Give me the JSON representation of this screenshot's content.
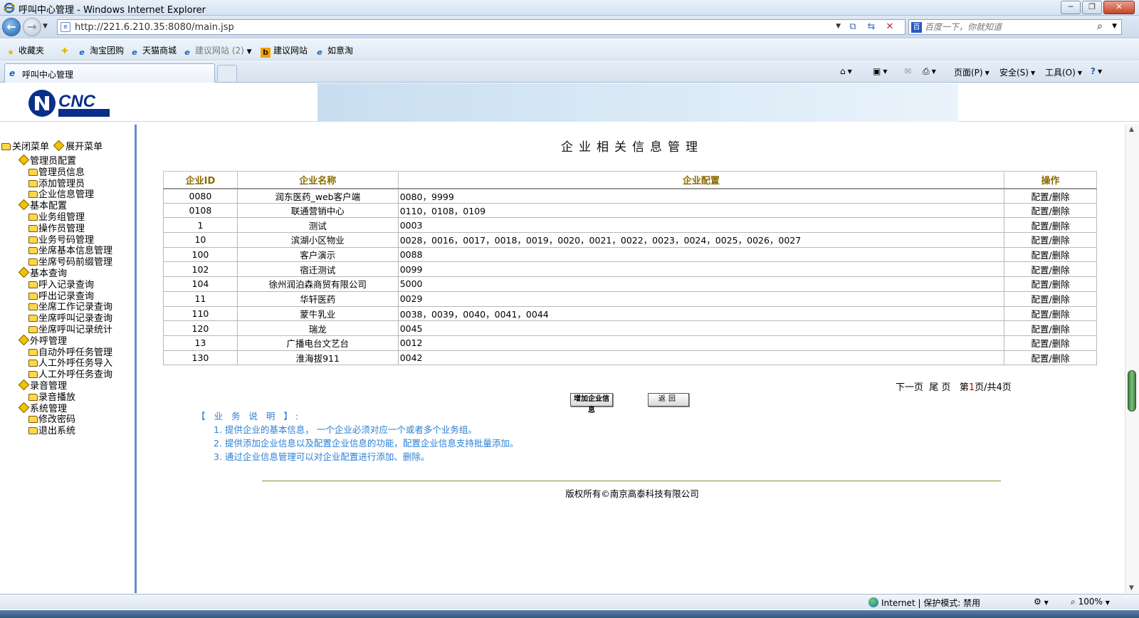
{
  "window": {
    "title": "呼叫中心管理 - Windows Internet Explorer",
    "minimize": "─",
    "restore": "❐",
    "close": "✕"
  },
  "address": {
    "url": "http://221.6.210.35:8080/main.jsp",
    "search_placeholder": "百度一下，你就知道"
  },
  "favorites": {
    "label": "收藏夹",
    "items": [
      "淘宝团购",
      "天猫商城",
      "建议网站 (2)",
      "建议网站",
      "如意淘"
    ]
  },
  "tab": {
    "label": "呼叫中心管理"
  },
  "commands": {
    "page": "页面(P)",
    "safety": "安全(S)",
    "tools": "工具(O)"
  },
  "sidebar": {
    "close_menu": "关闭菜单",
    "expand_menu": "展开菜单",
    "groups": [
      {
        "label": "管理员配置",
        "items": [
          "管理员信息",
          "添加管理员",
          "企业信息管理"
        ]
      },
      {
        "label": "基本配置",
        "items": [
          "业务组管理",
          "操作员管理",
          "业务号码管理",
          "坐席基本信息管理",
          "坐席号码前缀管理"
        ]
      },
      {
        "label": "基本查询",
        "items": [
          "呼入记录查询",
          "呼出记录查询",
          "坐席工作记录查询",
          "坐席呼叫记录查询",
          "坐席呼叫记录统计"
        ]
      },
      {
        "label": "外呼管理",
        "items": [
          "自动外呼任务管理",
          "人工外呼任务导入",
          "人工外呼任务查询"
        ]
      },
      {
        "label": "录音管理",
        "items": [
          "录音播放"
        ]
      },
      {
        "label": "系统管理",
        "items": [
          "修改密码",
          "退出系统"
        ]
      }
    ]
  },
  "main": {
    "title": "企业相关信息管理",
    "table": {
      "headers": [
        "企业ID",
        "企业名称",
        "企业配置",
        "操作"
      ],
      "rows": [
        [
          "0080",
          "润东医药_web客户端",
          "0080，9999",
          "配置/删除"
        ],
        [
          "0108",
          "联通营销中心",
          "0110，0108，0109",
          "配置/删除"
        ],
        [
          "1",
          "测试",
          "0003",
          "配置/删除"
        ],
        [
          "10",
          "滨湖小区物业",
          "0028，0016，0017，0018，0019，0020，0021，0022，0023，0024，0025，0026，0027",
          "配置/删除"
        ],
        [
          "100",
          "客户演示",
          "0088",
          "配置/删除"
        ],
        [
          "102",
          "宿迁测试",
          "0099",
          "配置/删除"
        ],
        [
          "104",
          "徐州润泊森商贸有限公司",
          "5000",
          "配置/删除"
        ],
        [
          "11",
          "华轩医药",
          "0029",
          "配置/删除"
        ],
        [
          "110",
          "蒙牛乳业",
          "0038，0039，0040，0041，0044",
          "配置/删除"
        ],
        [
          "120",
          "瑞龙",
          "0045",
          "配置/删除"
        ],
        [
          "13",
          "广播电台文艺台",
          "0012",
          "配置/删除"
        ],
        [
          "130",
          "淮海拔911",
          "0042",
          "配置/删除"
        ]
      ]
    },
    "pager": {
      "next": "下一页",
      "last": "尾 页",
      "page_prefix": "第",
      "current_page": "1",
      "page_suffix": "页/共4页"
    },
    "buttons": {
      "add": "增加企业信息",
      "back": "返回"
    },
    "notes": {
      "heading": "【 业 务 说 明 】:",
      "items": [
        "1.  提供企业的基本信息， 一个企业必须对应一个或者多个业务组。",
        "2.  提供添加企业信息以及配置企业信息的功能，配置企业信息支持批量添加。",
        "3.  通过企业信息管理可以对企业配置进行添加、删除。"
      ]
    },
    "copyright": "版权所有©南京高泰科技有限公司"
  },
  "status": {
    "zone": "Internet | 保护模式: 禁用",
    "zoom": "100%"
  },
  "colors": {
    "header_gold": "#8a6a00",
    "notes_blue": "#2a7fd4",
    "sidebar_border": "#5e8fc6"
  }
}
